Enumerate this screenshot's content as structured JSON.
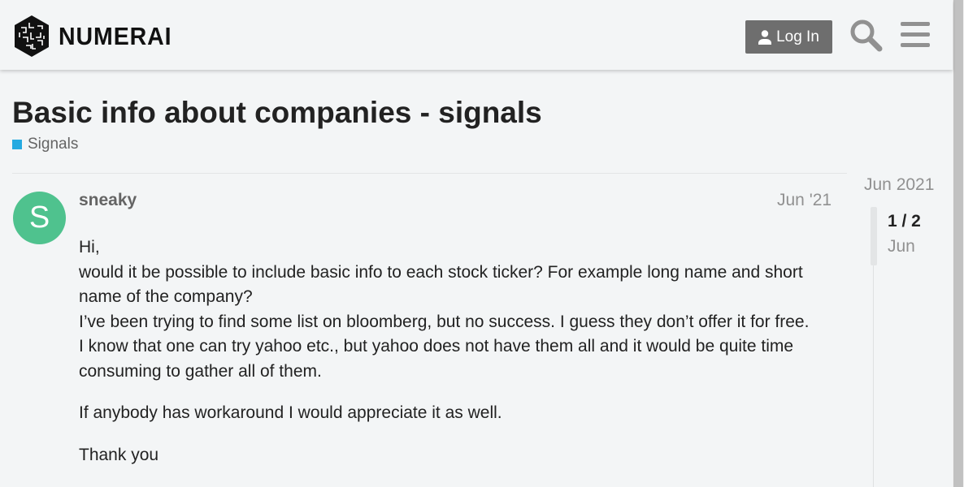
{
  "header": {
    "brand": "NUMERAI",
    "login_label": "Log In"
  },
  "topic": {
    "title": "Basic info about companies - signals",
    "category": "Signals",
    "category_color": "#25aae1"
  },
  "post": {
    "avatar_letter": "S",
    "avatar_color": "#4fc28e",
    "username": "sneaky",
    "date": "Jun '21",
    "paragraphs": [
      "Hi,",
      "would it be possible to include basic info to each stock ticker? For example long name and short name of the company?",
      "I’ve been trying to find some list on bloomberg, but no success. I guess they don’t offer it for free.",
      "I know that one can try yahoo etc., but yahoo does not have them all and it would be quite time consuming to gather all of them.",
      "If anybody has workaround I would appreciate it as well.",
      "Thank you"
    ]
  },
  "timeline": {
    "start_label": "Jun 2021",
    "position": "1 / 2",
    "current_date": "Jun"
  },
  "icons": [
    "user-icon",
    "search-icon",
    "hamburger-menu-icon",
    "numerai-logo-icon"
  ]
}
